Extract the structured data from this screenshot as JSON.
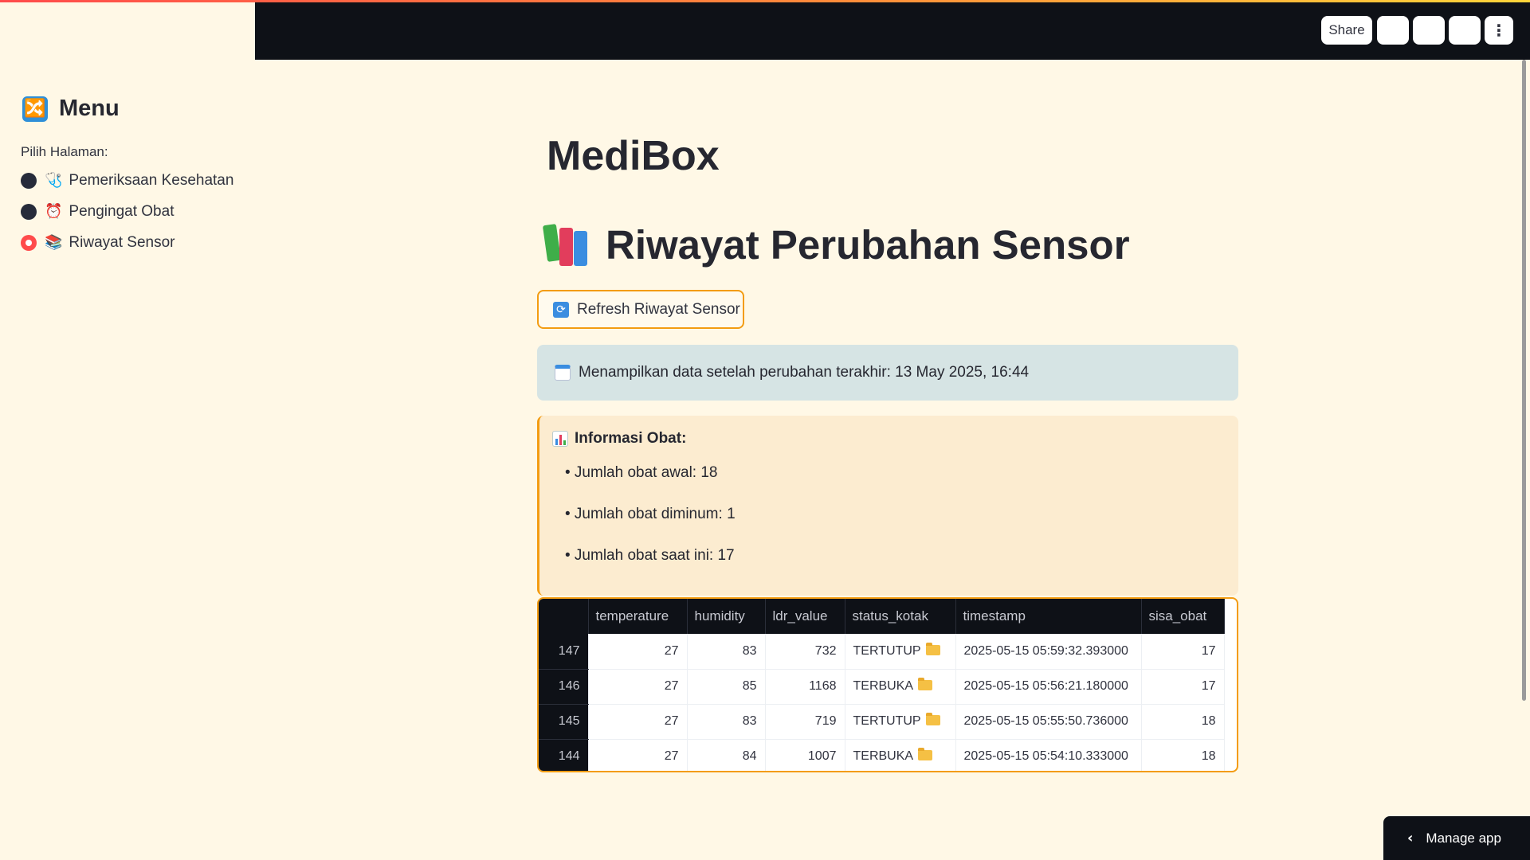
{
  "header": {
    "share_label": "Share",
    "menu_icon": "⋮"
  },
  "sidebar": {
    "title": "Menu",
    "title_icon": "🔀",
    "radio_label": "Pilih Halaman:",
    "items": [
      {
        "icon": "🩺",
        "label": "Pemeriksaan Kesehatan",
        "selected": false
      },
      {
        "icon": "⏰",
        "label": "Pengingat Obat",
        "selected": false
      },
      {
        "icon": "📚",
        "label": "Riwayat Sensor",
        "selected": true
      }
    ]
  },
  "main": {
    "app_title": "MediBox",
    "section_title": "Riwayat Perubahan Sensor",
    "refresh_button": "Refresh Riwayat Sensor",
    "info_text": "Menampilkan data setelah perubahan terakhir: 13 May 2025, 16:44",
    "obat_header": "Informasi Obat:",
    "obat_items": [
      "• Jumlah obat awal: 18",
      "• Jumlah obat diminum: 1",
      "• Jumlah obat saat ini: 17"
    ]
  },
  "table": {
    "columns": [
      "",
      "temperature",
      "humidity",
      "ldr_value",
      "status_kotak",
      "timestamp",
      "sisa_obat"
    ],
    "rows": [
      {
        "index": "147",
        "temperature": "27",
        "humidity": "83",
        "ldr_value": "732",
        "status_kotak": "TERTUTUP",
        "timestamp": "2025-05-15 05:59:32.393000",
        "sisa_obat": "17"
      },
      {
        "index": "146",
        "temperature": "27",
        "humidity": "85",
        "ldr_value": "1168",
        "status_kotak": "TERBUKA",
        "timestamp": "2025-05-15 05:56:21.180000",
        "sisa_obat": "17"
      },
      {
        "index": "145",
        "temperature": "27",
        "humidity": "83",
        "ldr_value": "719",
        "status_kotak": "TERTUTUP",
        "timestamp": "2025-05-15 05:55:50.736000",
        "sisa_obat": "18"
      },
      {
        "index": "144",
        "temperature": "27",
        "humidity": "84",
        "ldr_value": "1007",
        "status_kotak": "TERBUKA",
        "timestamp": "2025-05-15 05:54:10.333000",
        "sisa_obat": "18"
      }
    ]
  },
  "footer": {
    "manage_app_label": "Manage app"
  },
  "colors": {
    "accent": "#ff4b4b",
    "border_orange": "#f39c12",
    "header_bg": "#0e1117",
    "page_bg": "#fff8e6"
  }
}
